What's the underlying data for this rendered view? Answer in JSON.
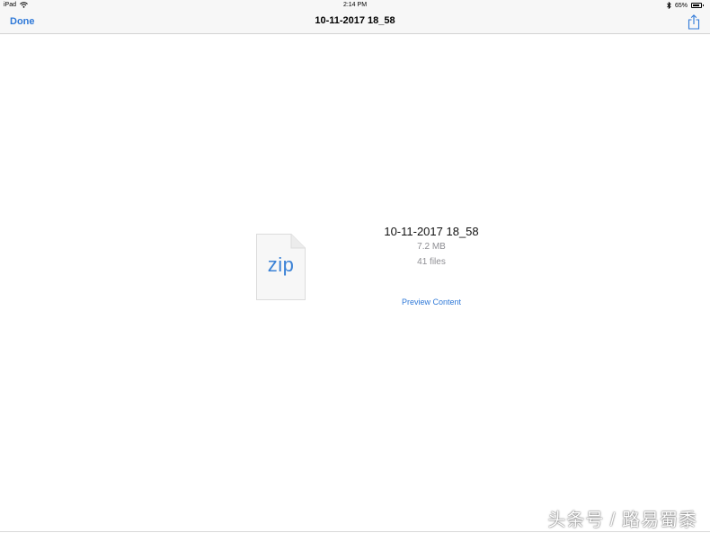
{
  "status_bar": {
    "device": "iPad",
    "time": "2:14 PM",
    "battery": "65%",
    "battery_level": 0.65,
    "icons": [
      "wifi-icon",
      "bluetooth-icon",
      "battery-icon"
    ]
  },
  "nav": {
    "done_label": "Done",
    "title": "10-11-2017 18_58",
    "share_icon": "share-icon"
  },
  "file": {
    "ext_label": "zip",
    "name": "10-11-2017 18_58",
    "size": "7.2 MB",
    "count": "41 files",
    "preview_label": "Preview Content"
  },
  "watermark": "头条号 / 路易蜀黍",
  "colors": {
    "accent": "#2f79d8",
    "secondary_text": "#8e8e93",
    "bar_background": "#f7f7f7"
  }
}
